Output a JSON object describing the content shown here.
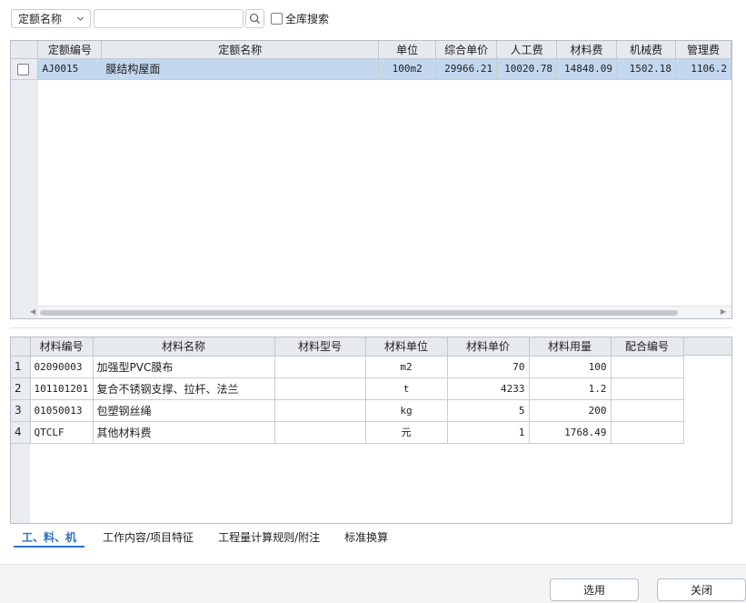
{
  "search": {
    "field_selected": "定额名称",
    "input_value": "",
    "global_search_label": "全库搜索"
  },
  "quota_table": {
    "columns": [
      "定额编号",
      "定额名称",
      "单位",
      "综合单价",
      "人工费",
      "材料费",
      "机械费",
      "管理费"
    ],
    "rows": [
      {
        "code": "AJ0015",
        "name": "膜结构屋面",
        "unit": "100m2",
        "unit_price": "29966.21",
        "labor": "10020.78",
        "material": "14848.09",
        "machine": "1502.18",
        "management": "1106.2",
        "selected": true
      }
    ]
  },
  "material_table": {
    "columns": [
      "材料编号",
      "材料名称",
      "材料型号",
      "材料单位",
      "材料单价",
      "材料用量",
      "配合编号"
    ],
    "rows": [
      {
        "index": "1",
        "code": "02090003",
        "name": "加强型PVC膜布",
        "model": "",
        "unit": "m2",
        "price": "70",
        "qty": "100",
        "mix": ""
      },
      {
        "index": "2",
        "code": "101101201",
        "name": "复合不锈钢支撑、拉杆、法兰",
        "model": "",
        "unit": "t",
        "price": "4233",
        "qty": "1.2",
        "mix": ""
      },
      {
        "index": "3",
        "code": "01050013",
        "name": "包塑钢丝绳",
        "model": "",
        "unit": "kg",
        "price": "5",
        "qty": "200",
        "mix": ""
      },
      {
        "index": "4",
        "code": "QTCLF",
        "name": "其他材料费",
        "model": "",
        "unit": "元",
        "price": "1",
        "qty": "1768.49",
        "mix": ""
      }
    ]
  },
  "tabs": [
    {
      "label": "工、料、机",
      "active": true
    },
    {
      "label": "工作内容/项目特征",
      "active": false
    },
    {
      "label": "工程量计算规则/附注",
      "active": false
    },
    {
      "label": "标准换算",
      "active": false
    }
  ],
  "footer": {
    "select_label": "选用",
    "close_label": "关闭"
  },
  "colors": {
    "accent": "#2a6fc9",
    "selected_row": "#c3d7ef",
    "header_bg": "#e6e9ed"
  },
  "icons": {
    "dropdown": "chevron-down-icon",
    "search": "search-icon"
  }
}
